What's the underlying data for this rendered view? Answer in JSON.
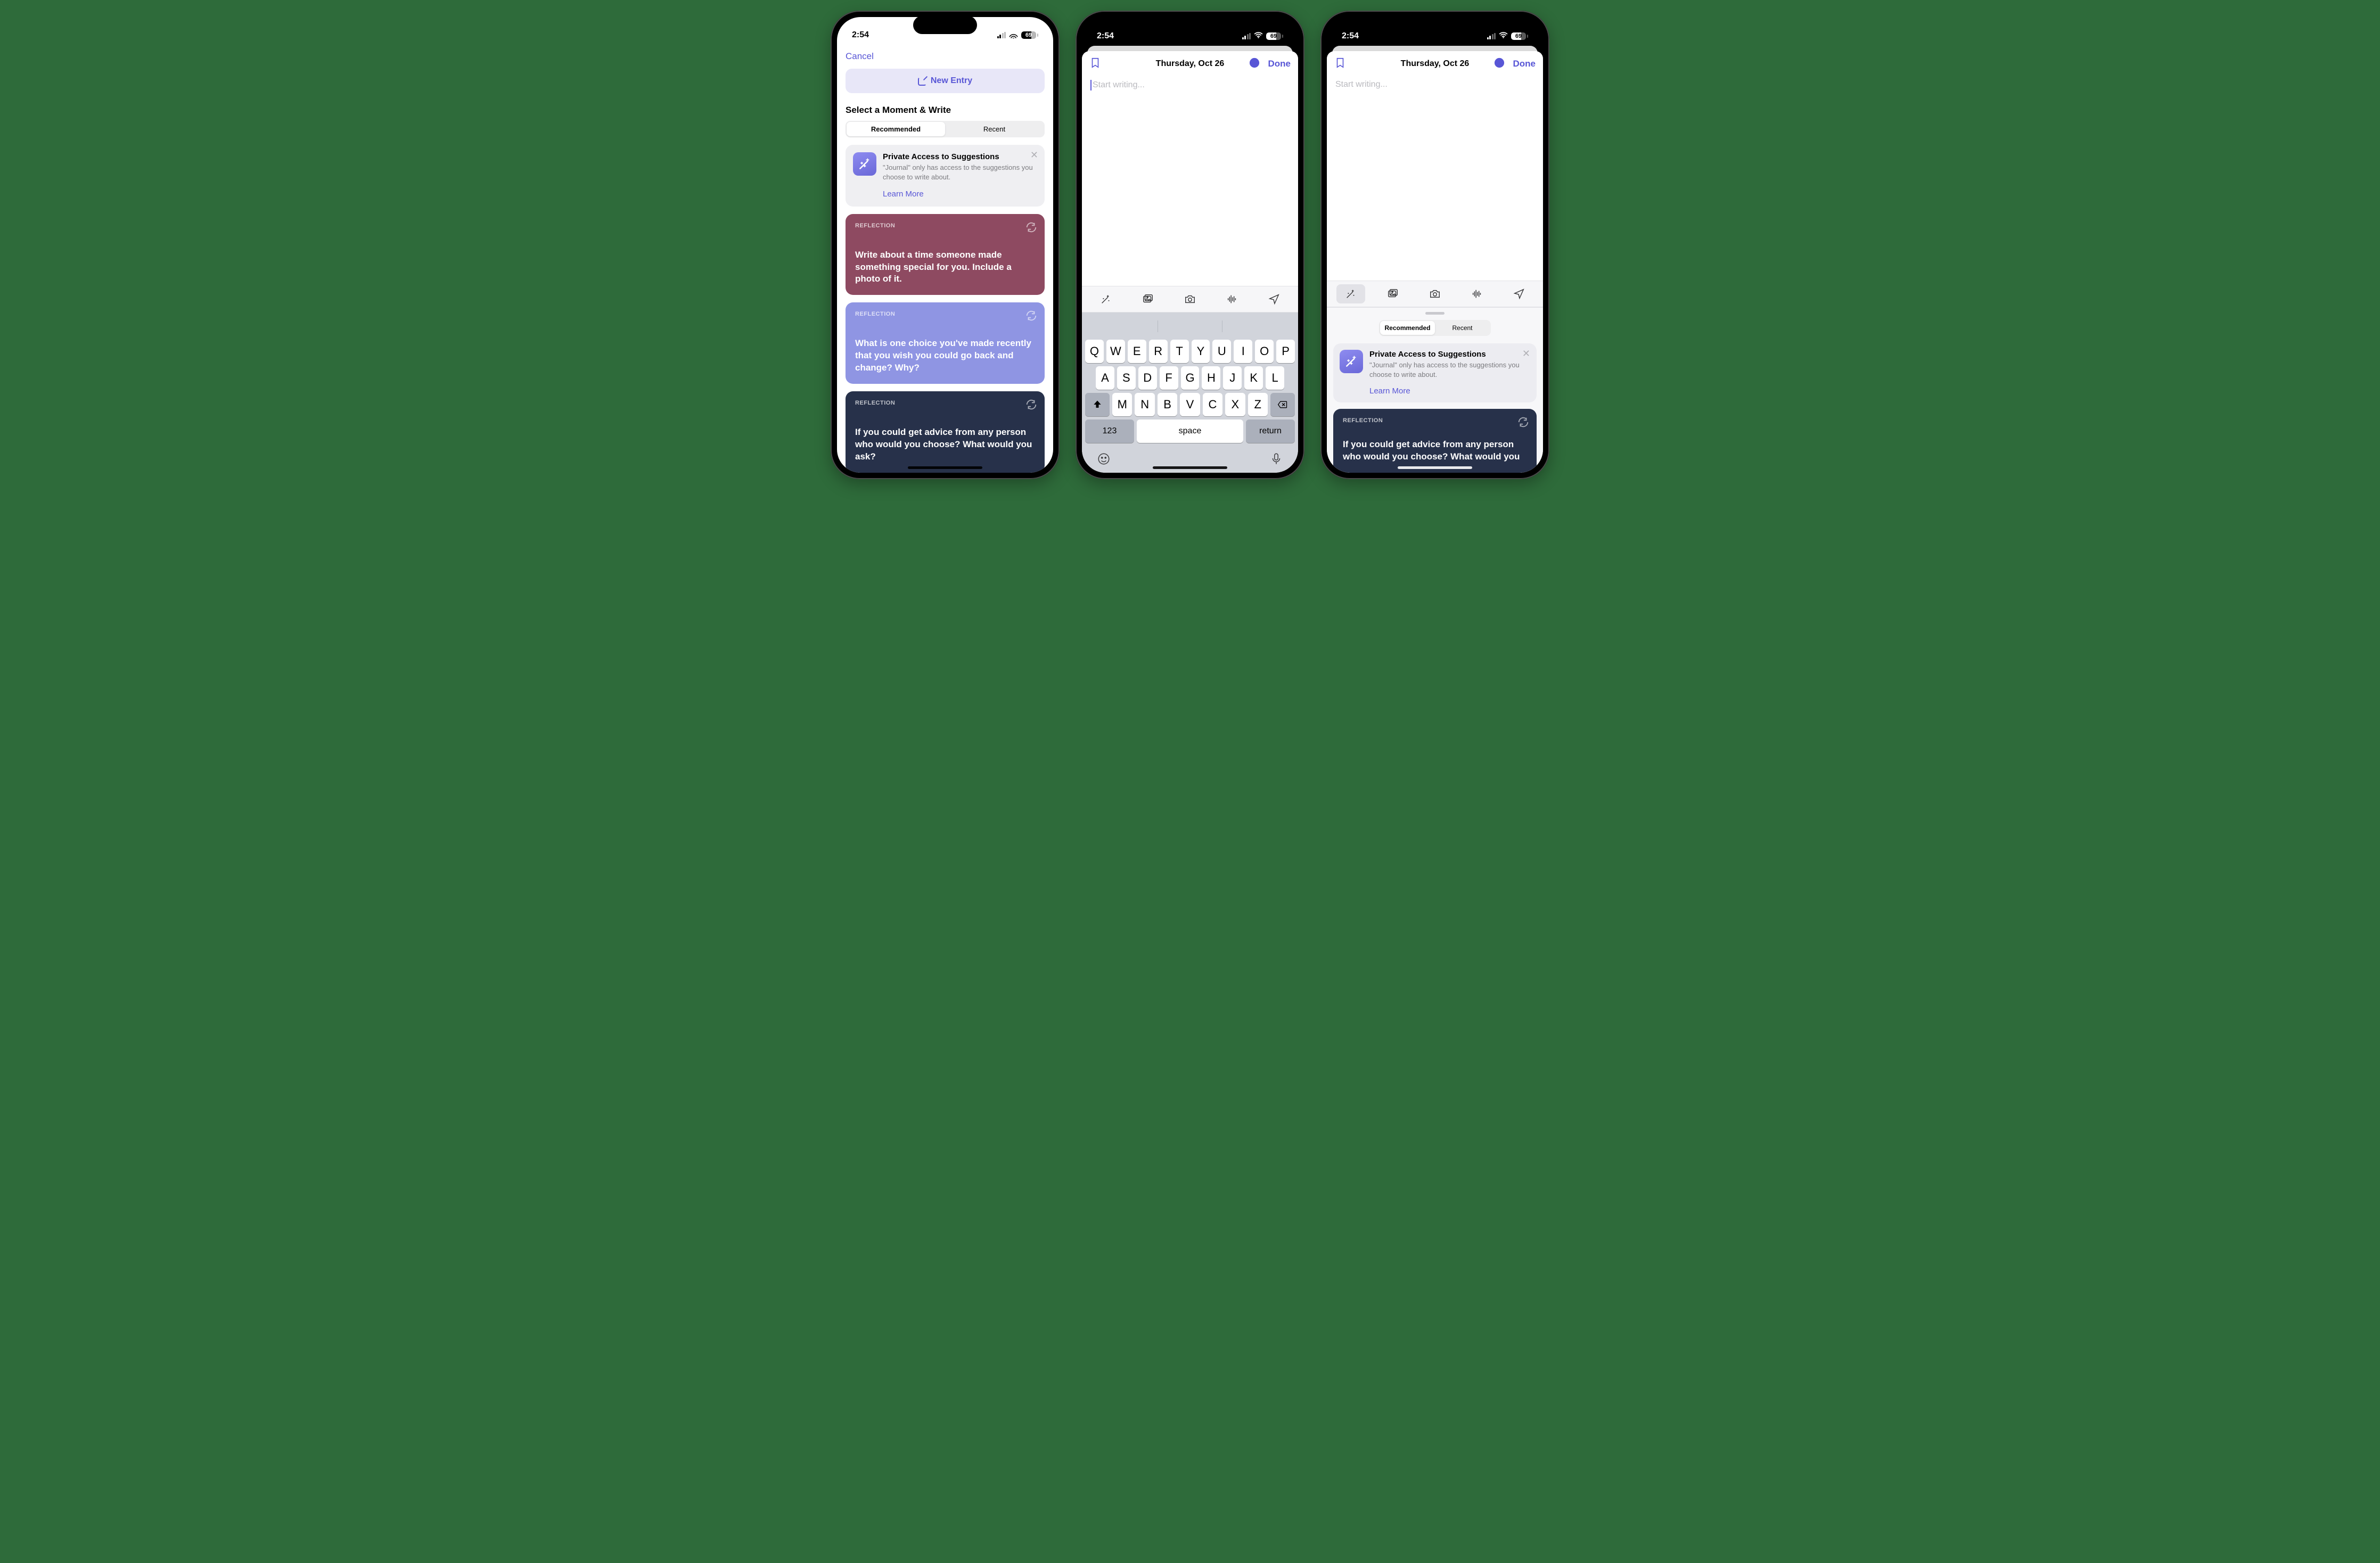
{
  "status": {
    "time": "2:54",
    "battery": "69"
  },
  "screen1": {
    "cancel": "Cancel",
    "new_entry": "New Entry",
    "section_title": "Select a Moment & Write",
    "segmented": {
      "recommended": "Recommended",
      "recent": "Recent"
    },
    "privacy": {
      "title": "Private Access to Suggestions",
      "body": "\"Journal\" only has access to the suggestions you choose to write about.",
      "learn_more": "Learn More"
    },
    "cards": [
      {
        "label": "REFLECTION",
        "prompt": "Write about a time someone made something special for you. Include a photo of it."
      },
      {
        "label": "REFLECTION",
        "prompt": "What is one choice you've made recently that you wish you could go back and change? Why?"
      },
      {
        "label": "REFLECTION",
        "prompt": "If you could get advice from any person who would you choose? What would you ask?"
      }
    ]
  },
  "editor": {
    "date": "Thursday, Oct 26",
    "done": "Done",
    "placeholder": "Start writing..."
  },
  "keyboard": {
    "row1": [
      "Q",
      "W",
      "E",
      "R",
      "T",
      "Y",
      "U",
      "I",
      "O",
      "P"
    ],
    "row2": [
      "A",
      "S",
      "D",
      "F",
      "G",
      "H",
      "J",
      "K",
      "L"
    ],
    "row3": [
      "Z",
      "X",
      "C",
      "V",
      "B",
      "N",
      "M"
    ],
    "numbers": "123",
    "space": "space",
    "return": "return"
  },
  "screen3": {
    "segmented": {
      "recommended": "Recommended",
      "recent": "Recent"
    },
    "privacy": {
      "title": "Private Access to Suggestions",
      "body": "\"Journal\" only has access to the suggestions you choose to write about.",
      "learn_more": "Learn More"
    },
    "card": {
      "label": "REFLECTION",
      "prompt": "If you could get advice from any person who would you choose? What would you"
    }
  }
}
